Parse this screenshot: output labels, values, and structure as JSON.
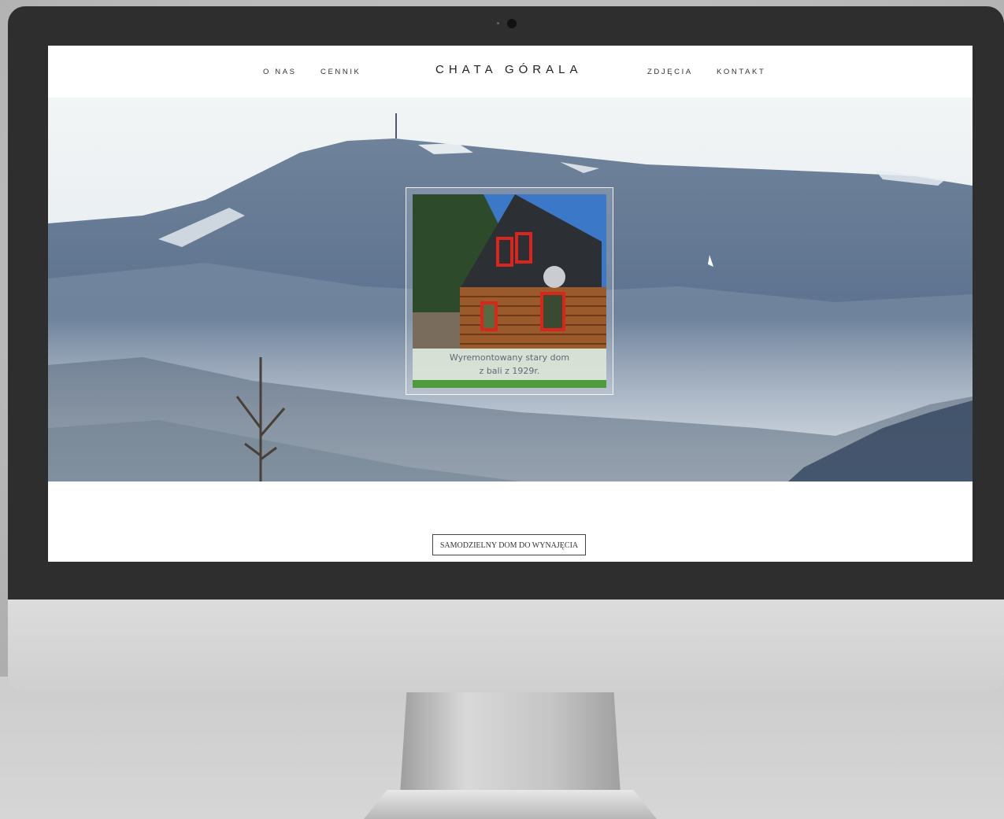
{
  "nav": {
    "left": [
      "O NAS",
      "CENNIK"
    ],
    "brand": "CHATA GÓRALA",
    "right": [
      "ZDJĘCIA",
      "KONTAKT"
    ]
  },
  "hero": {
    "caption_line1": "Wyremontowany stary dom",
    "caption_line2": "z bali z 1929r."
  },
  "cta": {
    "label": "SAMODZIELNY DOM DO WYNAJĘCIA"
  },
  "colors": {
    "bezel": "#2e2e2e",
    "screen_bg": "#ffffff",
    "grass": "#4f9a3a"
  },
  "icons": [
    "camera-icon"
  ]
}
